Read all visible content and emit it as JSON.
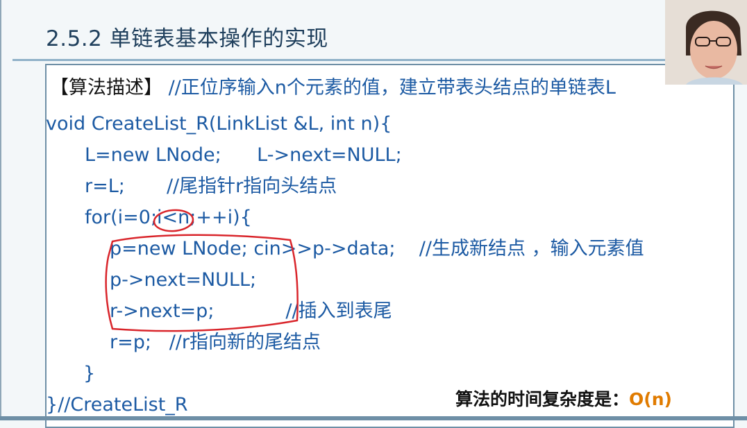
{
  "slide": {
    "title": "2.5.2 单链表基本操作的实现"
  },
  "code": {
    "header_bracket": "【算法描述】",
    "header_comment": " //正位序输入n个元素的值，建立带表头结点的单链表L",
    "lines": [
      "void CreateList_R(LinkList &L, int n){",
      "L=new LNode;      L->next=NULL;",
      "r=L;       //尾指针r指向头结点",
      "for(i=0;i<n;++i){",
      "p=new LNode; cin>>p->data;    //生成新结点 ，输入元素值",
      "p->next=NULL;",
      "r->next=p;            //插入到表尾",
      "r=p;   //r指向新的尾结点",
      "}",
      "}//CreateList_R"
    ]
  },
  "complexity": {
    "label": "算法的时间复杂度是：",
    "value": "O(n)"
  },
  "colors": {
    "code_text": "#1c5aa3",
    "annotation_ink": "#d9252b",
    "complexity_value": "#e07b00"
  }
}
